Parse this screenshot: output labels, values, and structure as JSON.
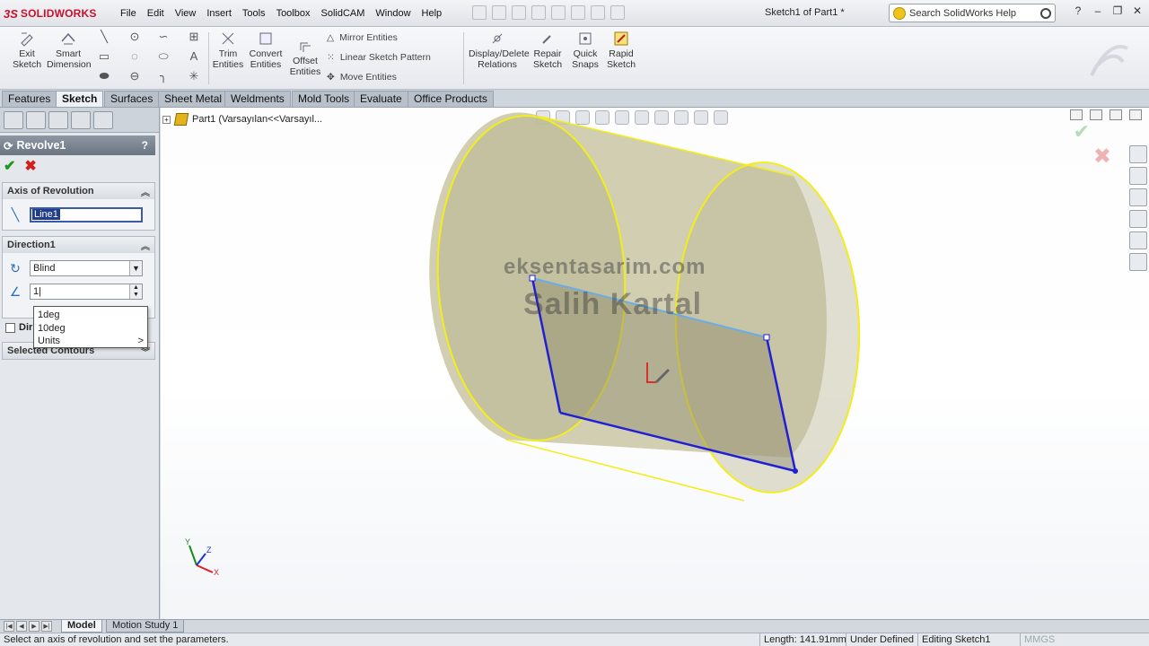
{
  "app": {
    "logo_ds": "3S",
    "logo_word": "SOLIDWORKS",
    "doc_title": "Sketch1 of Part1 *",
    "search_placeholder": "Search SolidWorks Help"
  },
  "menu": [
    "File",
    "Edit",
    "View",
    "Insert",
    "Tools",
    "Toolbox",
    "SolidCAM",
    "Window",
    "Help"
  ],
  "commands": {
    "exit_sketch": [
      "Exit",
      "Sketch"
    ],
    "smart_dimension": [
      "Smart",
      "Dimension"
    ],
    "trim_entities": [
      "Trim",
      "Entities"
    ],
    "convert_entities": [
      "Convert",
      "Entities"
    ],
    "offset_entities": [
      "Offset",
      "Entities"
    ],
    "mirror_entities": "Mirror Entities",
    "linear_sketch_pattern": "Linear Sketch Pattern",
    "move_entities": "Move Entities",
    "display_delete_relations": [
      "Display/Delete",
      "Relations"
    ],
    "repair_sketch": [
      "Repair",
      "Sketch"
    ],
    "quick_snaps": [
      "Quick",
      "Snaps"
    ],
    "rapid_sketch": [
      "Rapid",
      "Sketch"
    ]
  },
  "tabs": [
    "Features",
    "Sketch",
    "Surfaces",
    "Sheet Metal",
    "Weldments",
    "Mold Tools",
    "Evaluate",
    "Office Products"
  ],
  "active_tab": "Sketch",
  "property_manager": {
    "title": "Revolve1",
    "help": "?",
    "ok_symbol": "✔",
    "cancel_symbol": "✖",
    "axis_group": {
      "label": "Axis of Revolution",
      "value": "Line1"
    },
    "direction_group": {
      "label": "Direction1",
      "type": "Blind",
      "angle_value": "1|"
    },
    "unit_popup": [
      "1deg",
      "10deg",
      "Units"
    ],
    "direction2_label": "Dir",
    "contours_group": {
      "label": "Selected Contours"
    }
  },
  "feature_tree": {
    "root": "Part1  (Varsayılan<<Varsayıl..."
  },
  "watermark": {
    "line1": "eksentasarim.com",
    "line2": "Salih Kartal"
  },
  "triad": {
    "x": "X",
    "y": "Y",
    "z": "Z"
  },
  "bottom_tabs": [
    "Model",
    "Motion Study 1"
  ],
  "status": {
    "message": "Select an axis of revolution and set the parameters.",
    "length": "Length: 141.91mm",
    "state": "Under Defined",
    "mode": "Editing Sketch1",
    "units": "MMGS"
  },
  "colors": {
    "accent": "#3b5ba9",
    "sketch_line": "#1f1fd6",
    "axis_line": "#66aee8",
    "preview_edge": "#f2ee1a",
    "preview_fill": "#c9c6a4"
  }
}
